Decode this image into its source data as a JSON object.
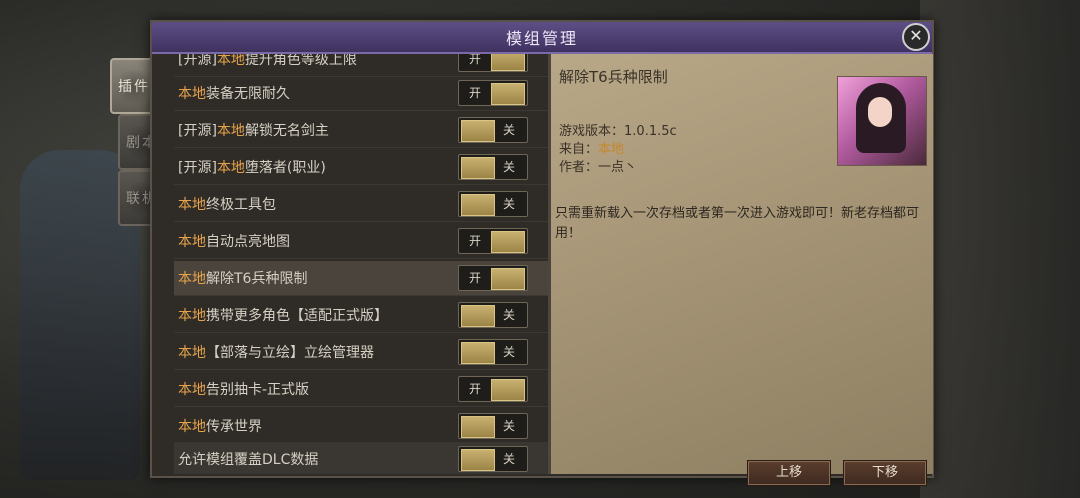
{
  "window": {
    "title": "模组管理"
  },
  "tabs": [
    {
      "label": "插件",
      "active": true
    },
    {
      "label": "剧本",
      "active": false
    },
    {
      "label": "联机",
      "active": false
    }
  ],
  "mods": [
    {
      "prefix": "[开源]",
      "local": "本地",
      "name": "提升角色等级上限",
      "state": "开"
    },
    {
      "prefix": "",
      "local": "本地",
      "name": "装备无限耐久",
      "state": "开"
    },
    {
      "prefix": "[开源]",
      "local": "本地",
      "name": "解锁无名剑主",
      "state": "关"
    },
    {
      "prefix": "[开源]",
      "local": "本地",
      "name": "堕落者(职业)",
      "state": "关"
    },
    {
      "prefix": "",
      "local": "本地",
      "name": "终极工具包",
      "state": "关"
    },
    {
      "prefix": "",
      "local": "本地",
      "name": "自动点亮地图",
      "state": "开"
    },
    {
      "prefix": "",
      "local": "本地",
      "name": "解除T6兵种限制",
      "state": "开",
      "selected": true
    },
    {
      "prefix": "",
      "local": "本地",
      "name": "携带更多角色【适配正式版】",
      "state": "关"
    },
    {
      "prefix": "",
      "local": "本地",
      "name": "【部落与立绘】立绘管理器",
      "state": "关"
    },
    {
      "prefix": "",
      "local": "本地",
      "name": "告别抽卡-正式版",
      "state": "开"
    },
    {
      "prefix": "",
      "local": "本地",
      "name": "传承世界",
      "state": "关"
    }
  ],
  "bottom_option": {
    "label": "允许模组覆盖DLC数据",
    "state": "关"
  },
  "detail": {
    "title": "解除T6兵种限制",
    "version_label": "游戏版本：",
    "version": "1.0.1.5c",
    "source_label": "来自：",
    "source": "本地",
    "author_label": "作者：",
    "author": "一点丶",
    "description": "只需重新载入一次存档或者第一次进入游戏即可！新老存档都可用！",
    "move_up": "上移",
    "move_down": "下移"
  },
  "colors": {
    "accent_local": "#e6a34a",
    "title_bar": "#4f4074"
  }
}
